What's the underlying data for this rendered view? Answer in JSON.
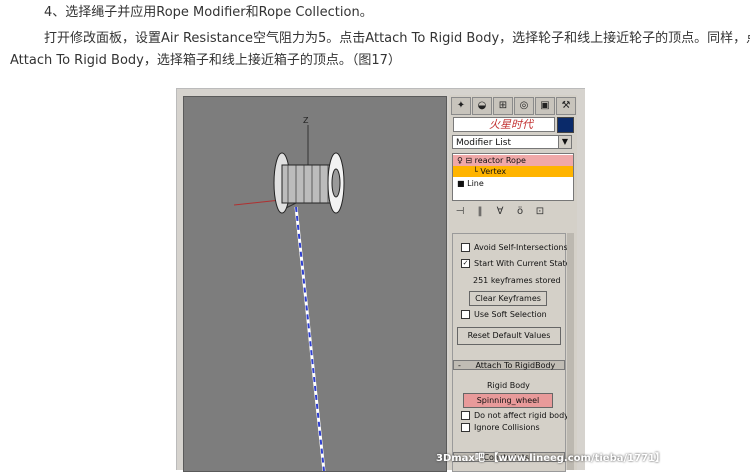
{
  "article": {
    "heading": "4、选择绳子并应用Rope Modifier和Rope Collection。",
    "line1": "打开修改面板，设置Air Resistance空气阻力为5。点击Attach To Rigid Body，选择轮子和线上接近轮子的顶点。同样，点击",
    "line2": "Attach To Rigid Body，选择箱子和线上接近箱子的顶点。（图17）"
  },
  "viewport": {
    "axis_label": "Z"
  },
  "panel": {
    "logo_text": "火星时代",
    "modifier_list": "Modifier List",
    "stack": [
      {
        "label": "reactor Rope",
        "level": 0,
        "color": "#f0a8a8"
      },
      {
        "label": "Vertex",
        "level": 1,
        "color": "#ffb400"
      },
      {
        "label": "Line",
        "level": 0,
        "color": "#ffffff"
      }
    ],
    "avoid_self": "Avoid Self-Intersections",
    "start_current": "Start With Current State",
    "keyframes": "251 keyframes stored",
    "clear_keyframes": "Clear Keyframes",
    "use_soft": "Use Soft Selection",
    "reset_defaults": "Reset Default Values",
    "attach_rollout": "Attach To RigidBody",
    "rigid_body_label": "Rigid Body",
    "rigid_body_value": "Spinning_wheel",
    "not_affect": "Do not affect rigid body",
    "ignore_collisions": "Ignore Collisions",
    "constraints": "Constraints"
  },
  "watermark": "3Dmax吧 【www.lineeg.com/tieba/1771】"
}
